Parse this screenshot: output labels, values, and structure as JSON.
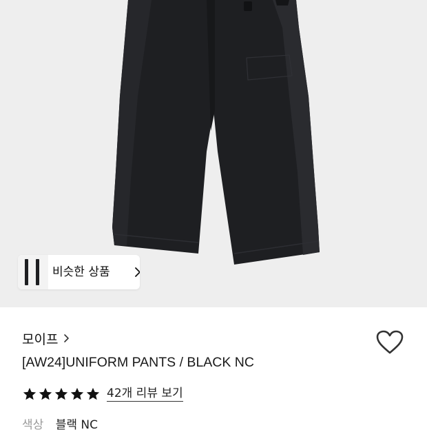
{
  "similar_button": {
    "label": "비슷한 상품"
  },
  "brand": {
    "name": "모이프"
  },
  "product": {
    "title": "[AW24]UNIFORM PANTS / BLACK NC"
  },
  "rating": {
    "stars": 5,
    "review_link": "42개 리뷰 보기"
  },
  "option": {
    "label": "색상",
    "value": "블랙 NC"
  },
  "colors": {
    "hero_bg": "#eeeeee",
    "pants": "#1e1f22",
    "star": "#111111"
  },
  "icons": [
    "chevron-right-icon",
    "heart-outline-icon",
    "star-icon"
  ]
}
